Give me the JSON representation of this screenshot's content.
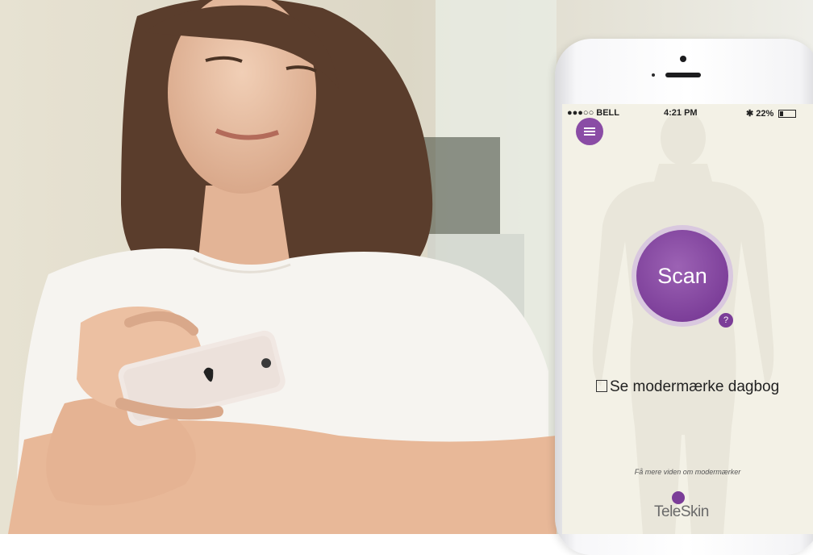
{
  "phone": {
    "status_bar": {
      "carrier": "●●●○○ BELL",
      "time": "4:21 PM",
      "battery": "22%",
      "battery_level": 0.22
    },
    "scan_label": "Scan",
    "help_label": "?",
    "diary_label": "Se modermærke dagbog",
    "learn_more": "Få mere viden om modermærker",
    "logo_text": "TeleSkin"
  },
  "colors": {
    "accent": "#7b3d98",
    "screen_bg": "#f3f1e6"
  }
}
